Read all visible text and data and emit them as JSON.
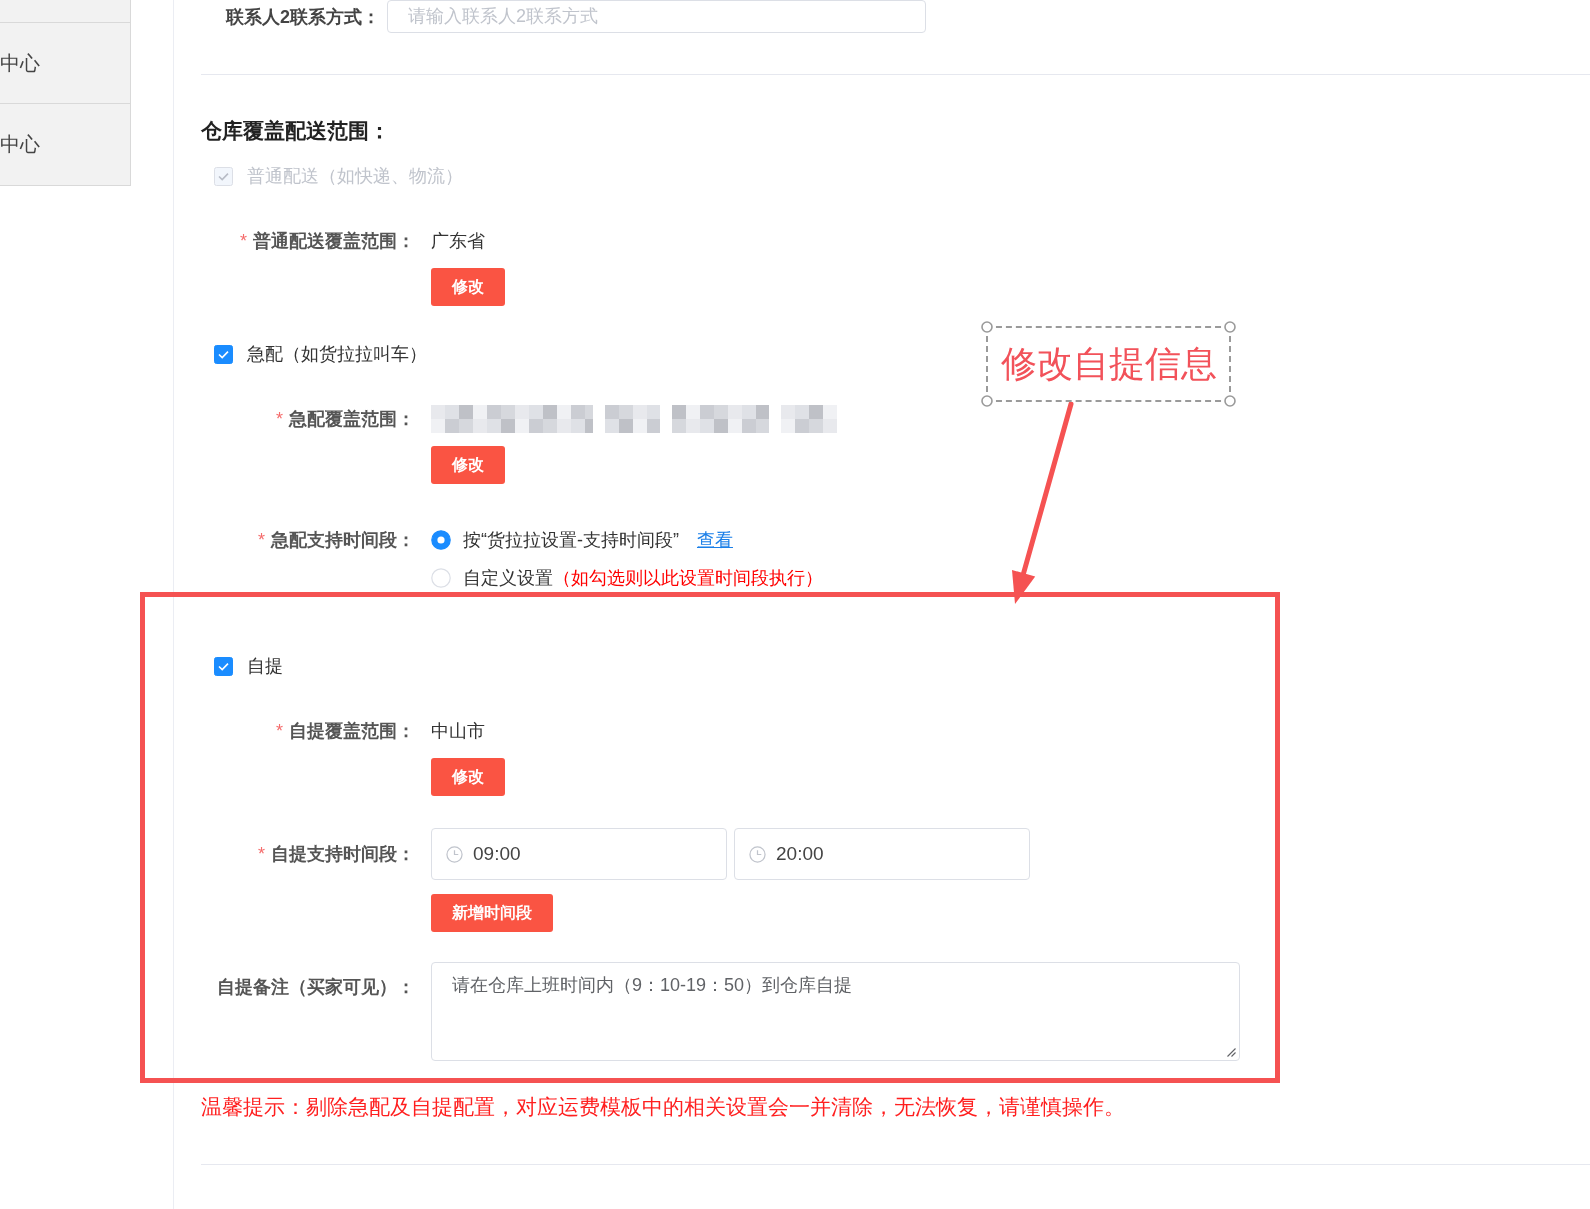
{
  "sidebar": {
    "items": [
      {
        "label": "中心"
      },
      {
        "label": "中心"
      }
    ]
  },
  "contact": {
    "label": "联系人2联系方式：",
    "placeholder": "请输入联系人2联系方式"
  },
  "coverage": {
    "title": "仓库覆盖配送范围：",
    "options": [
      {
        "label": "普通配送（如快递、物流）",
        "checked": true,
        "disabled": true,
        "highlighted": false,
        "fields": [
          {
            "kind": "region",
            "required_mark": "*",
            "label": "普通配送覆盖范围：",
            "value": "广东省",
            "button": "修改"
          }
        ]
      },
      {
        "label": "急配（如货拉拉叫车）",
        "checked": true,
        "disabled": false,
        "highlighted": false,
        "fields": [
          {
            "kind": "redacted",
            "required_mark": "*",
            "label": "急配覆盖范围：",
            "button": "修改"
          },
          {
            "kind": "radio",
            "required_mark": "*",
            "label": "急配支持时间段：",
            "choices": [
              {
                "label": "按“货拉拉设置-支持时间段”",
                "link": "查看",
                "selected": true
              },
              {
                "label": "自定义设置",
                "note": "（如勾选则以此设置时间段执行）",
                "selected": false
              }
            ]
          }
        ]
      },
      {
        "label": "自提",
        "checked": true,
        "disabled": false,
        "highlighted": true,
        "fields": [
          {
            "kind": "region",
            "required_mark": "*",
            "label": "自提覆盖范围：",
            "value": "中山市",
            "button": "修改"
          },
          {
            "kind": "time_range",
            "required_mark": "*",
            "label": "自提支持时间段：",
            "times": [
              "09:00",
              "20:00"
            ],
            "button": "新增时间段"
          },
          {
            "kind": "textarea",
            "label": "自提备注（买家可见）：",
            "value": "请在仓库上班时间内（9：10-19：50）到仓库自提"
          }
        ]
      }
    ],
    "warning": "温馨提示：剔除急配及自提配置，对应运费模板中的相关设置会一并清除，无法恢复，请谨慎操作。"
  },
  "annotation": {
    "text": "修改自提信息"
  }
}
